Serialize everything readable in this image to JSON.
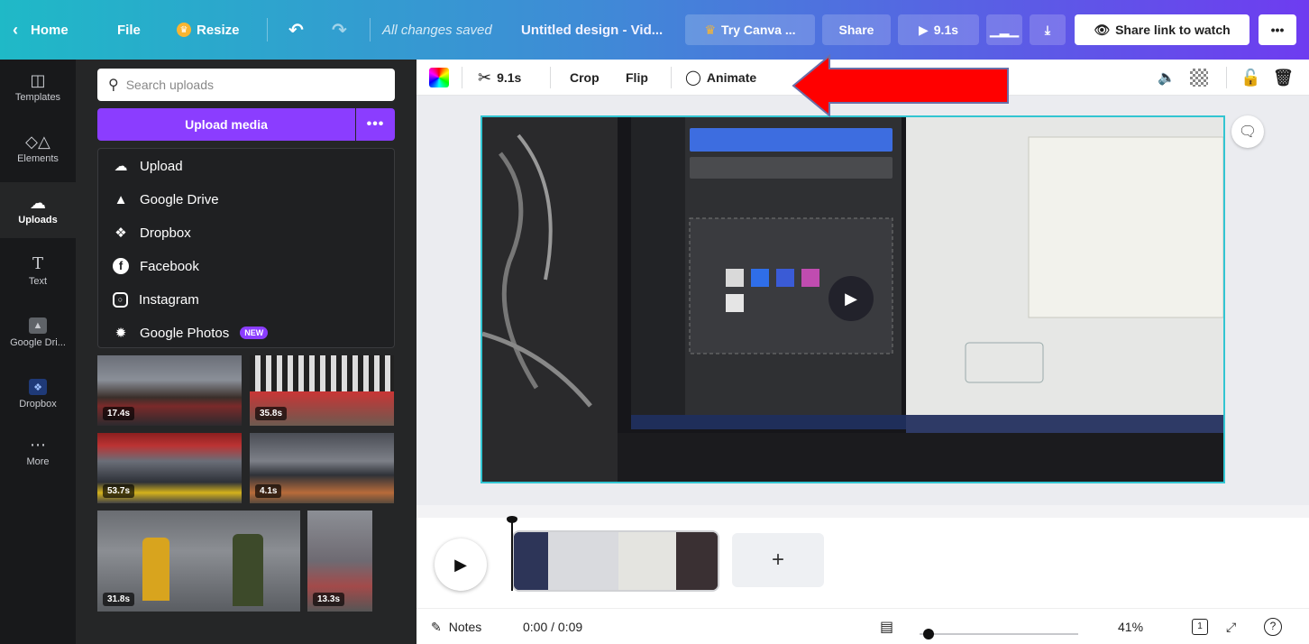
{
  "topbar": {
    "home_label": "Home",
    "file_label": "File",
    "resize_label": "Resize",
    "saved_status": "All changes saved",
    "design_title": "Untitled design - Vid...",
    "try_canva_label": "Try Canva ...",
    "share_label": "Share",
    "duration_label": "9.1s",
    "share_link_label": "Share link to watch",
    "more_label": "•••"
  },
  "rail": {
    "items": [
      {
        "label": "Templates",
        "icon": "templates-icon"
      },
      {
        "label": "Elements",
        "icon": "elements-icon"
      },
      {
        "label": "Uploads",
        "icon": "upload-cloud-icon"
      },
      {
        "label": "Text",
        "icon": "text-icon"
      },
      {
        "label": "Google Dri...",
        "icon": "google-drive-app-icon"
      },
      {
        "label": "Dropbox",
        "icon": "dropbox-app-icon"
      },
      {
        "label": "More",
        "icon": "more-icon"
      }
    ]
  },
  "panel": {
    "search_placeholder": "Search uploads",
    "upload_button": "Upload media",
    "upload_more": "•••",
    "menu": [
      {
        "label": "Upload",
        "icon": "upload-icon"
      },
      {
        "label": "Google Drive",
        "icon": "google-drive-icon"
      },
      {
        "label": "Dropbox",
        "icon": "dropbox-icon"
      },
      {
        "label": "Facebook",
        "icon": "facebook-icon"
      },
      {
        "label": "Instagram",
        "icon": "instagram-icon"
      },
      {
        "label": "Google Photos",
        "icon": "google-photos-icon",
        "badge": "NEW"
      }
    ],
    "videos": [
      {
        "duration": "17.4s"
      },
      {
        "duration": "35.8s"
      },
      {
        "duration": "53.7s"
      },
      {
        "duration": "4.1s"
      },
      {
        "duration": "31.8s"
      },
      {
        "duration": "13.3s"
      }
    ]
  },
  "editor_toolbar": {
    "trim_duration": "9.1s",
    "crop_label": "Crop",
    "flip_label": "Flip",
    "animate_label": "Animate"
  },
  "footer": {
    "notes_label": "Notes",
    "time_readout": "0:00 / 0:09",
    "zoom_label": "41%",
    "page_count": "1"
  },
  "colors": {
    "accent_purple": "#8b3dff",
    "selection_cyan": "#32c5d2",
    "annotation_red": "#ff0000"
  }
}
